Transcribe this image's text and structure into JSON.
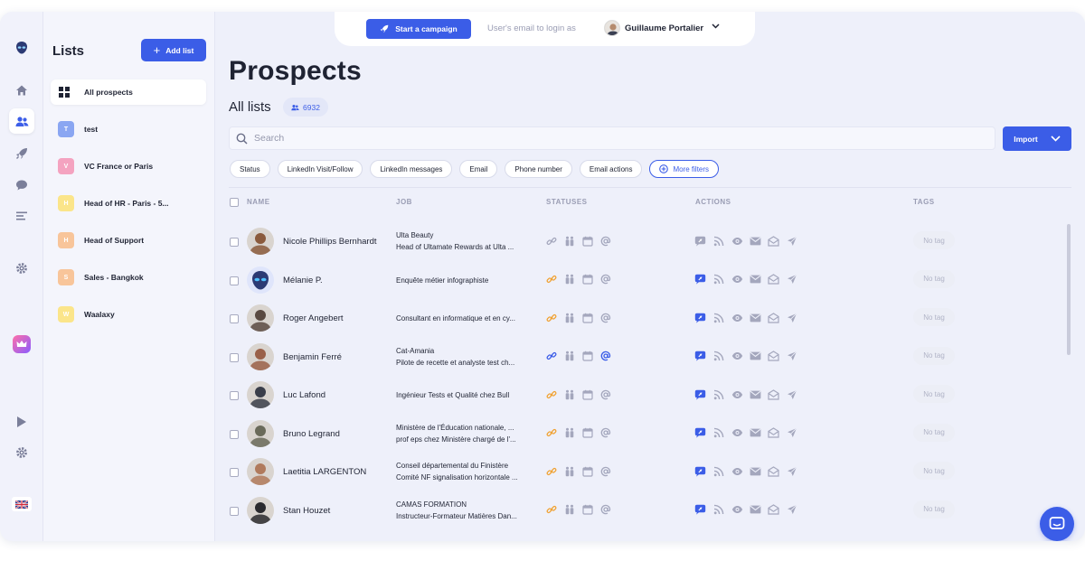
{
  "topbar": {
    "campaign_label": "Start a campaign",
    "login_placeholder": "User's email to login as",
    "user_name": "Guillaume Portalier"
  },
  "lists_panel": {
    "title": "Lists",
    "add_label": "Add list",
    "items": [
      {
        "label": "All prospects",
        "badge": "",
        "color": ""
      },
      {
        "label": "test",
        "badge": "T",
        "color": "#8aa6f2"
      },
      {
        "label": "VC France or Paris",
        "badge": "V",
        "color": "#f4a3c0"
      },
      {
        "label": "Head of HR - Paris - 5...",
        "badge": "H",
        "color": "#fbe58a"
      },
      {
        "label": "Head of Support",
        "badge": "H",
        "color": "#f8c59a"
      },
      {
        "label": "Sales - Bangkok",
        "badge": "S",
        "color": "#f8c59a"
      },
      {
        "label": "Waalaxy",
        "badge": "W",
        "color": "#fbe58a"
      }
    ]
  },
  "main": {
    "title": "Prospects",
    "subtitle": "All lists",
    "count": "6932",
    "search_placeholder": "Search",
    "import_label": "Import",
    "filters": [
      "Status",
      "LinkedIn Visit/Follow",
      "LinkedIn messages",
      "Email",
      "Phone number",
      "Email actions"
    ],
    "more_filters": "More filters",
    "columns": {
      "name": "NAME",
      "job": "JOB",
      "statuses": "STATUSES",
      "actions": "ACTIONS",
      "tags": "TAGS"
    }
  },
  "prospects": [
    {
      "name": "Nicole Phillips Bernhardt",
      "job1": "Ulta Beauty",
      "job2": "Head of Ultamate Rewards at Ulta ...",
      "tag": "No tag",
      "active": [
        false,
        false,
        false,
        false
      ],
      "avatar_color": "#8a5a3c"
    },
    {
      "name": "Mélanie P.",
      "job1": "Enquête métier infographiste",
      "job2": "",
      "tag": "No tag",
      "active": [
        true,
        false,
        false,
        false
      ],
      "avatar_color": "#3b5de7"
    },
    {
      "name": "Roger Angebert",
      "job1": "Consultant en informatique et en cy...",
      "job2": "",
      "tag": "No tag",
      "active": [
        true,
        false,
        false,
        false
      ],
      "avatar_color": "#5a4a42"
    },
    {
      "name": "Benjamin Ferré",
      "job1": "Cat-Amania",
      "job2": "Pilote de recette et analyste test ch...",
      "tag": "No tag",
      "active": [
        true,
        false,
        false,
        true
      ],
      "avatar_color": "#9a6048"
    },
    {
      "name": "Luc Lafond",
      "job1": "Ingénieur Tests et Qualité chez Bull",
      "job2": "",
      "tag": "No tag",
      "active": [
        true,
        false,
        false,
        false
      ],
      "avatar_color": "#3a3e4a"
    },
    {
      "name": "Bruno Legrand",
      "job1": "Ministère de l'Éducation nationale, ...",
      "job2": "prof eps chez Ministère chargé de l'...",
      "tag": "No tag",
      "active": [
        true,
        false,
        false,
        false
      ],
      "avatar_color": "#6a6a5a"
    },
    {
      "name": "Laetitia LARGENTON",
      "job1": "Conseil départemental du Finistère",
      "job2": "Comité NF signalisation horizontale ...",
      "tag": "No tag",
      "active": [
        true,
        false,
        false,
        false
      ],
      "avatar_color": "#b07a5c"
    },
    {
      "name": "Stan Houzet",
      "job1": "CAMAS FORMATION",
      "job2": "Instructeur-Formateur Matières Dan...",
      "tag": "No tag",
      "active": [
        true,
        false,
        false,
        false
      ],
      "avatar_color": "#2a2a2e"
    }
  ],
  "colors": {
    "accent": "#3b5de7",
    "link_orange": "#f0a233",
    "link_blue": "#3b5de7",
    "icon_gray": "#a4a7bd"
  },
  "icons": [
    "home-icon",
    "users-icon",
    "rocket-icon",
    "chat-icon",
    "filter-icon",
    "gear-icon",
    "crown-icon",
    "play-icon",
    "flag-uk-icon"
  ]
}
